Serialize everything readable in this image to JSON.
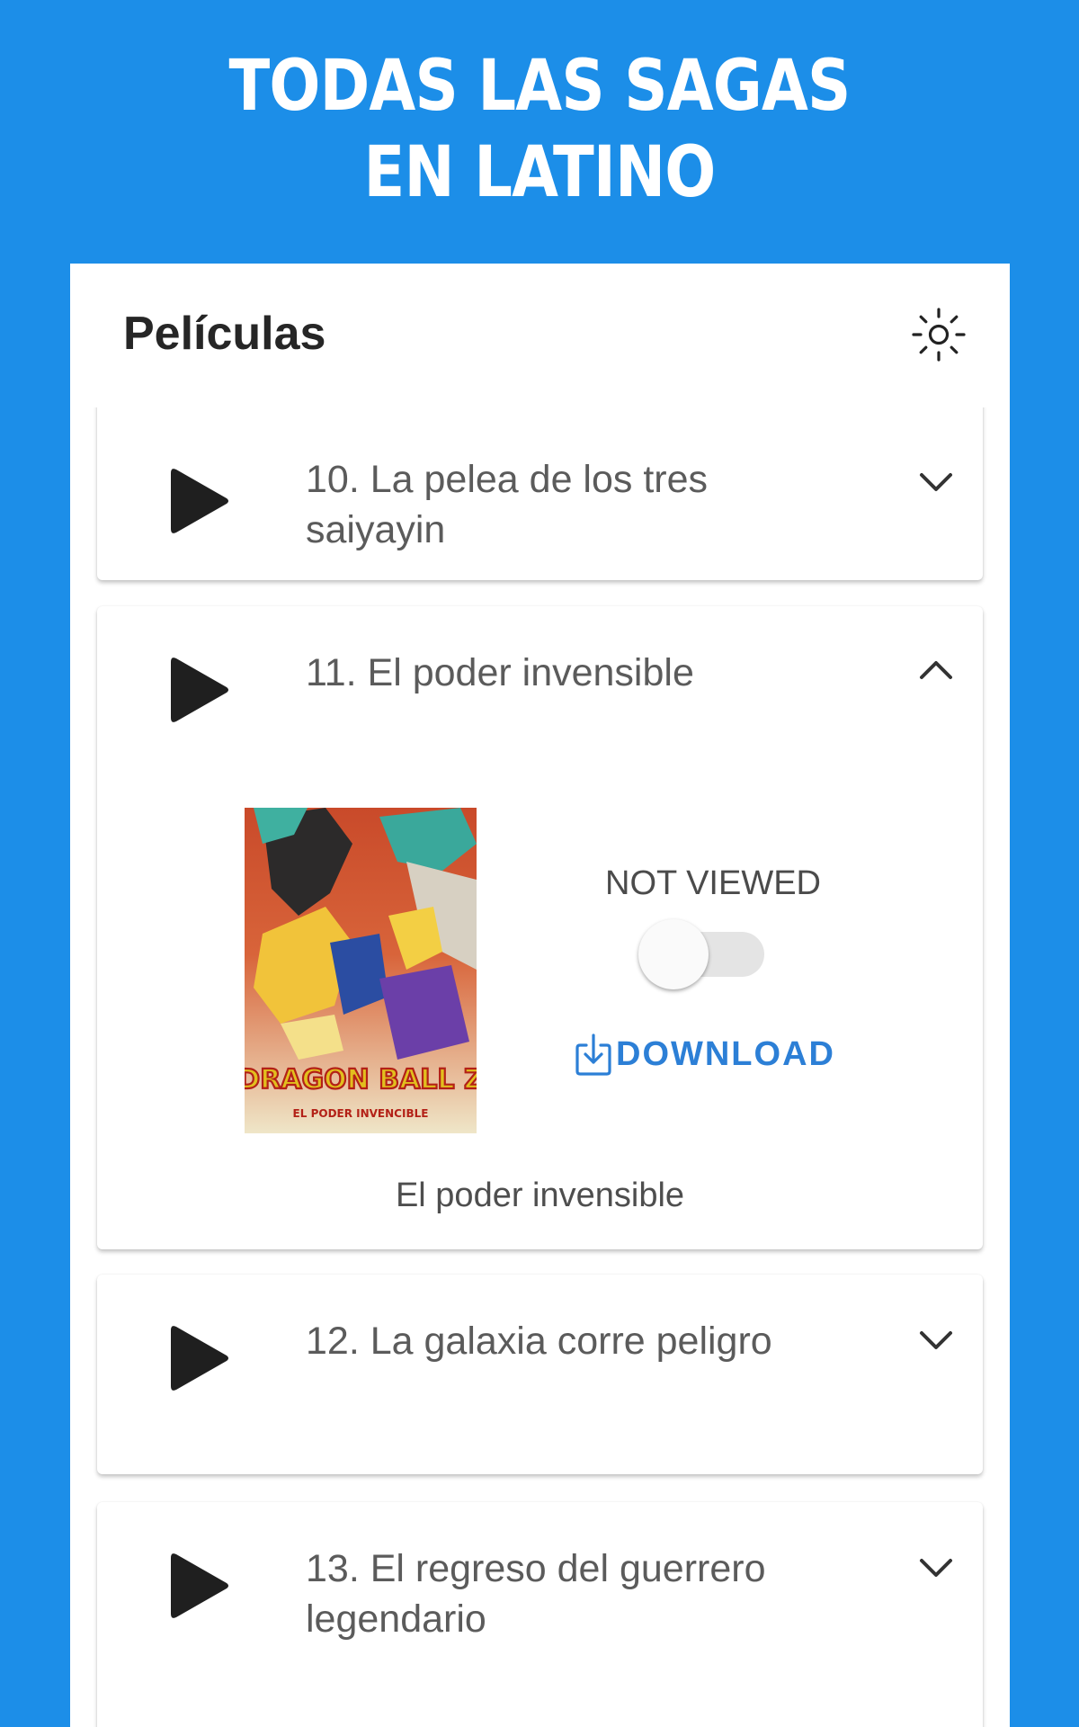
{
  "promo": {
    "line1": "TODAS LAS SAGAS",
    "line2": "EN LATINO"
  },
  "appbar": {
    "title": "Películas",
    "theme_icon": "sun-icon"
  },
  "movies": [
    {
      "title_line1": "10. La pelea de los tres",
      "title_line2": "saiyayin",
      "expanded": false
    },
    {
      "title_line1": "11. El poder invensible",
      "title_line2": "",
      "expanded": true
    },
    {
      "title_line1": "12. La galaxia corre peligro",
      "title_line2": "",
      "expanded": false
    },
    {
      "title_line1": "13. El regreso del guerrero",
      "title_line2": "legendario",
      "expanded": false
    }
  ],
  "expanded": {
    "status_label": "NOT VIEWED",
    "viewed": false,
    "download_label": "DOWNLOAD",
    "caption": "El poder invensible",
    "poster_logo_main": "DRAGON BALL Z",
    "poster_logo_sub": "EL PODER INVENCIBLE"
  },
  "colors": {
    "brand_blue": "#1c8ee8",
    "accent": "#2c7fd6",
    "text_primary": "#262626",
    "text_secondary": "#5b5b5b"
  },
  "icons": {
    "play": "play-icon",
    "expand": "chevron-down-icon",
    "collapse": "chevron-up-icon",
    "download": "download-icon"
  }
}
